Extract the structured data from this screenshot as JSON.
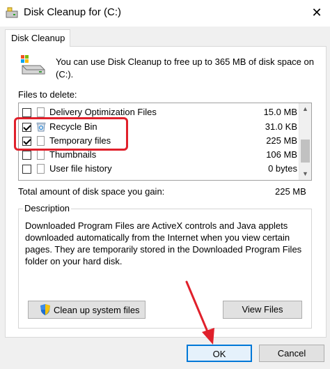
{
  "window": {
    "title": "Disk Cleanup for  (C:)",
    "close_glyph": "✕"
  },
  "tab": {
    "label": "Disk Cleanup"
  },
  "intro_text": "You can use Disk Cleanup to free up to 365 MB of disk space on (C:).",
  "files_to_delete_label": "Files to delete:",
  "files": [
    {
      "name": "Delivery Optimization Files",
      "size": "15.0 MB",
      "checked": false,
      "icon": "file-icon"
    },
    {
      "name": "Recycle Bin",
      "size": "31.0 KB",
      "checked": true,
      "icon": "recycle-bin-icon"
    },
    {
      "name": "Temporary files",
      "size": "225 MB",
      "checked": true,
      "icon": "file-icon"
    },
    {
      "name": "Thumbnails",
      "size": "106 MB",
      "checked": false,
      "icon": "file-icon"
    },
    {
      "name": "User file history",
      "size": "0 bytes",
      "checked": false,
      "icon": "file-icon"
    }
  ],
  "total": {
    "label": "Total amount of disk space you gain:",
    "value": "225 MB"
  },
  "description": {
    "legend": "Description",
    "text": "Downloaded Program Files are ActiveX controls and Java applets downloaded automatically from the Internet when you view certain pages. They are temporarily stored in the Downloaded Program Files folder on your hard disk."
  },
  "buttons": {
    "cleanup_system": "Clean up system files",
    "view_files": "View Files",
    "ok": "OK",
    "cancel": "Cancel"
  },
  "colors": {
    "highlight": "#e0202b",
    "accent": "#0078d7"
  }
}
